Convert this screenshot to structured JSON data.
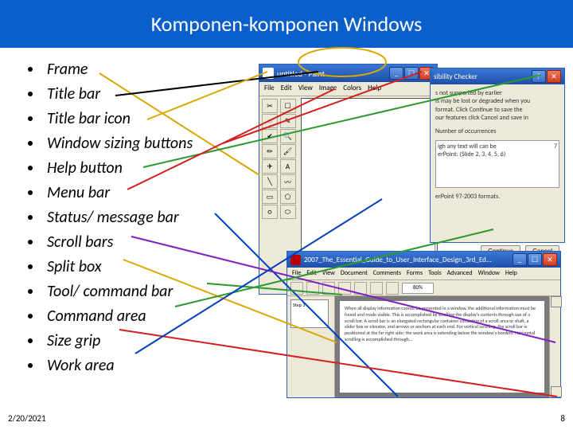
{
  "header": {
    "title": "Komponen-komponen Windows"
  },
  "bullets": [
    "Frame",
    "Title bar",
    "Title bar icon",
    "Window sizing buttons",
    "Help button",
    "Menu bar",
    "Status/ message bar",
    "Scroll bars",
    "Split box",
    "Tool/ command bar",
    "Command area",
    "Size grip",
    "Work area"
  ],
  "paint": {
    "title": "untitled - Paint",
    "menu": [
      "File",
      "Edit",
      "View",
      "Image",
      "Colors",
      "Help"
    ],
    "tools": [
      "✂",
      "☐",
      "◌",
      "✎",
      "✔",
      "🔍",
      "✏",
      "🖌",
      "✈",
      "A",
      "╲",
      "〰",
      "▭",
      "⬠",
      "○",
      "⬭"
    ]
  },
  "compat": {
    "title": "sibility Checker",
    "text1": "s not supported by earlier",
    "text2": "is may be lost or degraded when you",
    "text3": "format. Click Continue to save the",
    "text4": "our features click Cancel and save in",
    "summary_label": "Number of occurrences",
    "item1": "igh any text will can be",
    "item2": "erPoint: (Slide 2, 3, 4, 5, 6)",
    "count1": "7",
    "footer": "erPoint 97-2003 formats.",
    "btn1": "Continue",
    "btn2": "Cancel"
  },
  "reader": {
    "title": "2007_The_Essential_Guide_to_User_Interface_Design_3rd_Ed...",
    "menu": [
      "File",
      "Edit",
      "View",
      "Document",
      "Comments",
      "Forms",
      "Tools",
      "Advanced",
      "Window",
      "Help"
    ],
    "zoom": "80%",
    "page_label": "Step 3",
    "page_text": "When all display information cannot be presented in a window, the additional information must be found and made visible. This is accomplished by scrolling the display's contents through use of a scroll bar. A scroll bar is an elongated rectangular container consisting of a scroll area or shaft, a slider box or elevator, and arrows or anchors at each end. For vertical scrolling, the scroll bar is positioned at the far right side; the work area is extending below the window's borders. Horizontal scrolling is accomplished through..."
  },
  "footer": {
    "date": "2/20/2021",
    "page": "8"
  },
  "line_colors": {
    "frame": "#d9a800",
    "titlebar": "#000000",
    "titlebaricon": "#d9a800",
    "sizing": "#d02020",
    "help": "#2a9a30",
    "menubar": "#d02020",
    "status": "#0040c0",
    "scroll": "#8020c0",
    "split": "#d9a800",
    "toolbar": "#2a9a30",
    "command": "#2a9a30",
    "sizegrip": "#d02020",
    "work": "#0040c0"
  }
}
